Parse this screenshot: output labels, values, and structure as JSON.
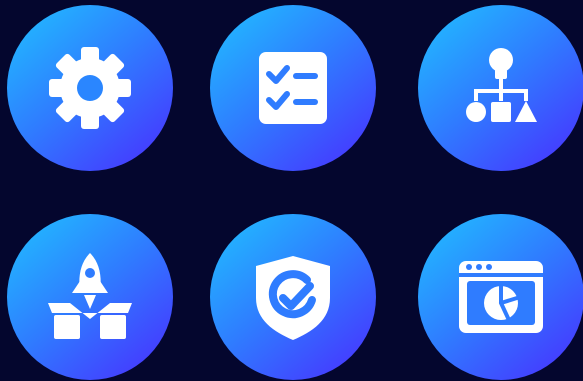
{
  "background_color": "#04062e",
  "badge_gradient": [
    "#1fc2ff",
    "#2f7cff",
    "#4a2bff"
  ],
  "icon_color": "#ffffff",
  "icons": [
    {
      "name": "gear-icon"
    },
    {
      "name": "checklist-icon"
    },
    {
      "name": "idea-flowchart-icon"
    },
    {
      "name": "rocket-launch-icon"
    },
    {
      "name": "shield-check-icon"
    },
    {
      "name": "browser-pie-chart-icon"
    }
  ]
}
